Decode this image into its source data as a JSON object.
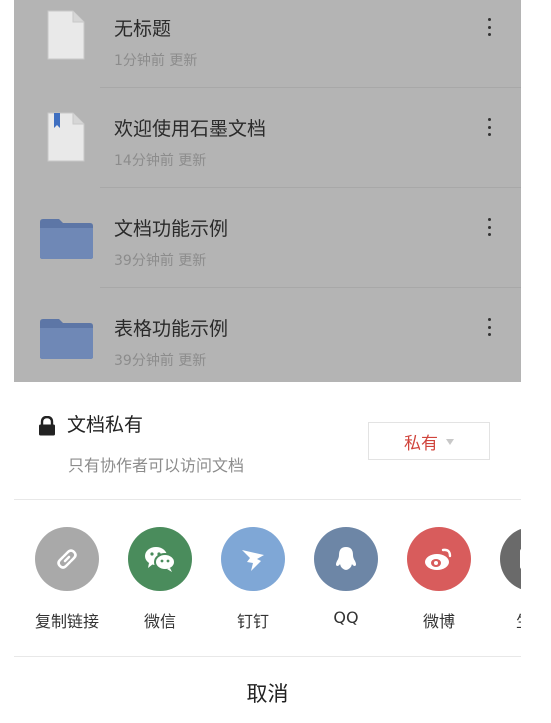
{
  "files": [
    {
      "title": "无标题",
      "meta": "1分钟前 更新",
      "icon": "doc-blank-icon"
    },
    {
      "title": "欢迎使用石墨文档",
      "meta": "14分钟前 更新",
      "icon": "doc-bookmark-icon"
    },
    {
      "title": "文档功能示例",
      "meta": "39分钟前 更新",
      "icon": "folder-icon"
    },
    {
      "title": "表格功能示例",
      "meta": "39分钟前 更新",
      "icon": "folder-icon"
    }
  ],
  "privacy": {
    "title": "文档私有",
    "description": "只有协作者可以访问文档",
    "selected": "私有"
  },
  "share": [
    {
      "label": "复制链接",
      "icon": "link-icon",
      "color": "#a9a9a9"
    },
    {
      "label": "微信",
      "icon": "wechat-icon",
      "color": "#4a8c5c"
    },
    {
      "label": "钉钉",
      "icon": "dingtalk-icon",
      "color": "#7fa7d6"
    },
    {
      "label": "QQ",
      "icon": "qq-icon",
      "color": "#6d86a6"
    },
    {
      "label": "微博",
      "icon": "weibo-icon",
      "color": "#d85c5c"
    },
    {
      "label": "生成",
      "icon": "image-icon",
      "color": "#6a6a6a"
    }
  ],
  "cancel_label": "取消"
}
